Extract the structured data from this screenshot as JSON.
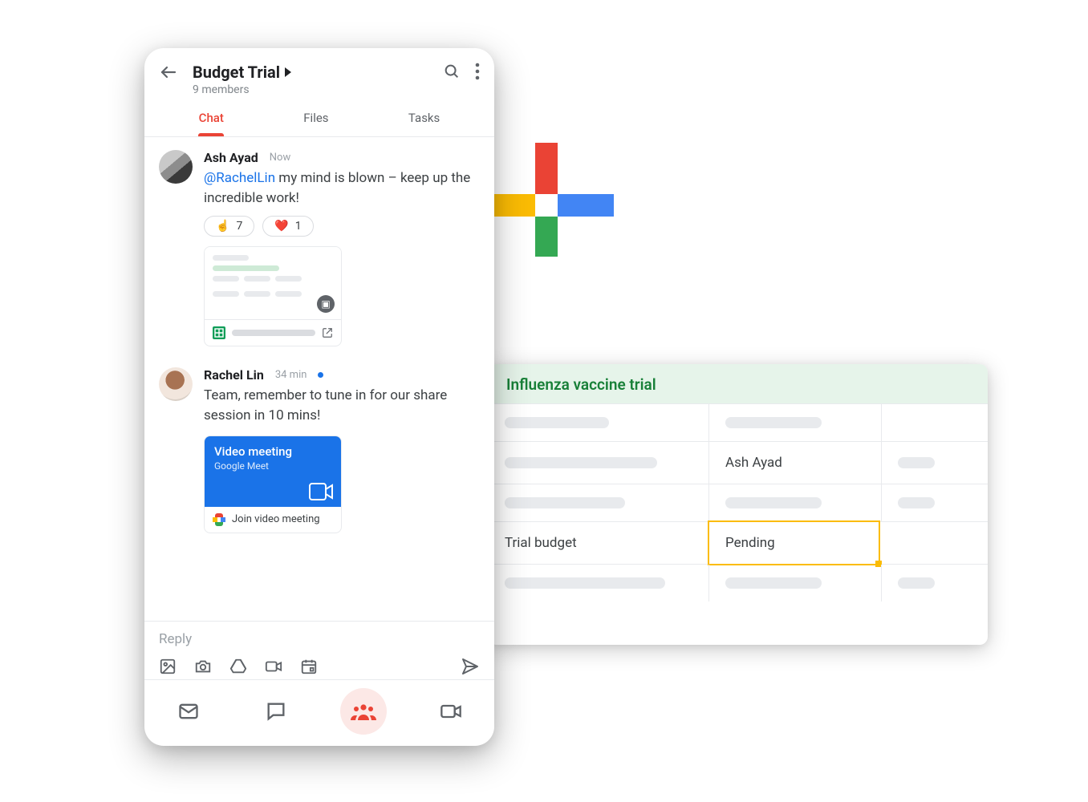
{
  "phone": {
    "room_name": "Budget Trial",
    "members": "9 members",
    "tabs": {
      "chat": "Chat",
      "files": "Files",
      "tasks": "Tasks"
    },
    "msg1": {
      "author": "Ash Ayad",
      "time": "Now",
      "mention": "@RachelLin",
      "text_rest": " my mind is blown – keep up the incredible work!",
      "react1_emoji": "☝️",
      "react1_count": "7",
      "react2_emoji": "❤️",
      "react2_count": "1"
    },
    "msg2": {
      "author": "Rachel Lin",
      "time": "34 min",
      "text": "Team, remember to tune in for our share session in 10 mins!",
      "meet_title": "Video meeting",
      "meet_sub": "Google Meet",
      "join_label": "Join video meeting"
    },
    "reply_placeholder": "Reply"
  },
  "sheet": {
    "title": "Influenza vaccine trial",
    "cell_b2": "Ash Ayad",
    "cell_a4": "Trial budget",
    "cell_b4": "Pending"
  },
  "colors": {
    "accent_red": "#EA4335",
    "accent_blue": "#1A73E8",
    "accent_green": "#188038",
    "accent_yellow": "#FBBC04"
  }
}
